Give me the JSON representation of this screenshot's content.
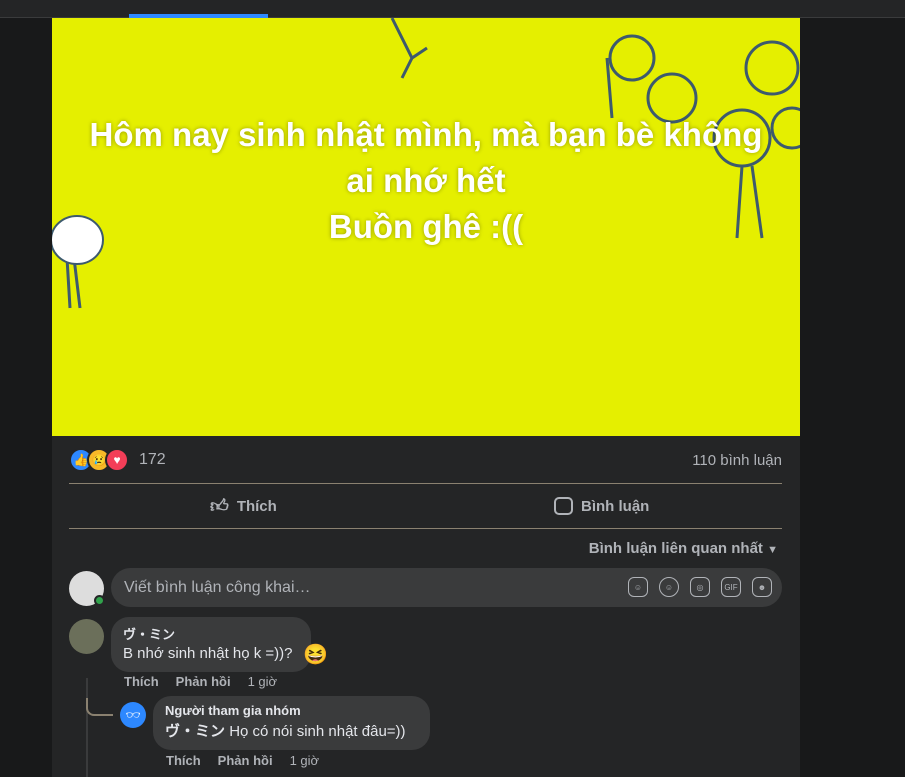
{
  "post": {
    "caption_lines": [
      "Hôm nay sinh nhật mình, mà bạn bè không",
      "ai nhớ hết",
      "Buồn ghê :(("
    ],
    "reaction_count": "172",
    "comment_count": "110 bình luận",
    "like_label": "Thích",
    "comment_label": "Bình luận",
    "sort_label": "Bình luận liên quan nhất",
    "input_placeholder": "Viết bình luận công khai…"
  },
  "comments": [
    {
      "author": "ヴ・ミン",
      "text": "B nhớ sinh nhật họ k =))?",
      "like": "Thích",
      "reply": "Phản hồi",
      "time": "1 giờ"
    },
    {
      "author": "Người tham gia nhóm",
      "mention": "ヴ・ミン",
      "text": "Họ có nói sinh nhật đâu=))",
      "like": "Thích",
      "reply": "Phản hồi",
      "time": "1 giờ"
    }
  ],
  "colors": {
    "accent": "#2d88ff",
    "media_bg": "#e5ef00"
  }
}
